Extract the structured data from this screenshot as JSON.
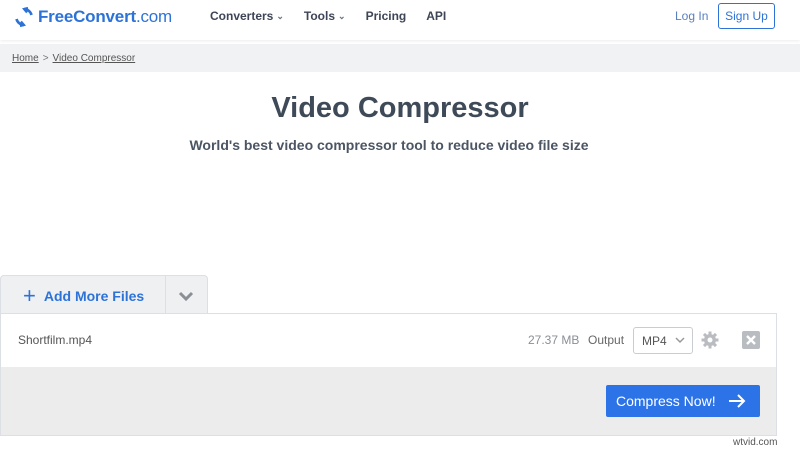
{
  "header": {
    "logo_text_a": "FreeConvert",
    "logo_text_b": ".com",
    "nav": {
      "converters": "Converters",
      "tools": "Tools",
      "pricing": "Pricing",
      "api": "API"
    },
    "login": "Log In",
    "signup": "Sign Up"
  },
  "breadcrumb": {
    "home": "Home",
    "separator": ">",
    "current": "Video Compressor"
  },
  "page": {
    "title": "Video Compressor",
    "subtitle": "World's best video compressor tool to reduce video file size"
  },
  "uploader": {
    "add_more": "Add More Files",
    "file": {
      "name": "Shortfilm.mp4",
      "size": "27.37 MB",
      "output_label": "Output",
      "format": "MP4"
    },
    "compress_label": "Compress Now!"
  },
  "watermark": "wtvid.com",
  "colors": {
    "brand": "#2d73d7",
    "button": "#2d73e8"
  },
  "icons": [
    "refresh-logo-icon",
    "chevron-down-icon",
    "plus-icon",
    "gear-icon",
    "close-icon",
    "arrow-right-icon"
  ]
}
